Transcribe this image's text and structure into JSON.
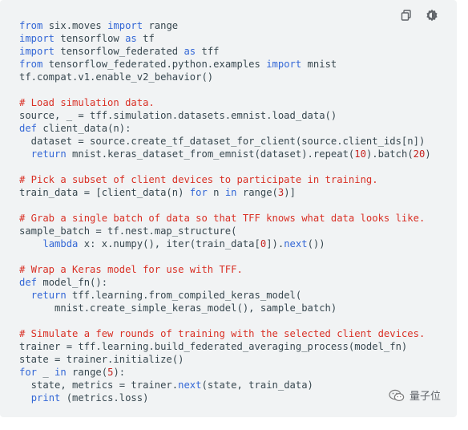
{
  "toolbar": {
    "copy_icon": "copy-icon",
    "theme_icon": "settings-brightness-icon"
  },
  "code": {
    "lines": [
      [
        {
          "t": "from",
          "c": "kw"
        },
        {
          "t": " six.moves ",
          "c": ""
        },
        {
          "t": "import",
          "c": "kw"
        },
        {
          "t": " range",
          "c": ""
        }
      ],
      [
        {
          "t": "import",
          "c": "kw"
        },
        {
          "t": " tensorflow ",
          "c": ""
        },
        {
          "t": "as",
          "c": "kw"
        },
        {
          "t": " tf",
          "c": ""
        }
      ],
      [
        {
          "t": "import",
          "c": "kw"
        },
        {
          "t": " tensorflow_federated ",
          "c": ""
        },
        {
          "t": "as",
          "c": "kw"
        },
        {
          "t": " tff",
          "c": ""
        }
      ],
      [
        {
          "t": "from",
          "c": "kw"
        },
        {
          "t": " tensorflow_federated.python.examples ",
          "c": ""
        },
        {
          "t": "import",
          "c": "kw"
        },
        {
          "t": " mnist",
          "c": ""
        }
      ],
      [
        {
          "t": "tf.compat.v1.enable_v2_behavior()",
          "c": ""
        }
      ],
      [
        {
          "t": "",
          "c": ""
        }
      ],
      [
        {
          "t": "# Load simulation data.",
          "c": "cm"
        }
      ],
      [
        {
          "t": "source, _ = tff.simulation.datasets.emnist.load_data()",
          "c": ""
        }
      ],
      [
        {
          "t": "def",
          "c": "kw"
        },
        {
          "t": " client_data(n):",
          "c": ""
        }
      ],
      [
        {
          "t": "  dataset = source.create_tf_dataset_for_client(source.client_ids[n])",
          "c": ""
        }
      ],
      [
        {
          "t": "  ",
          "c": ""
        },
        {
          "t": "return",
          "c": "kw"
        },
        {
          "t": " mnist.keras_dataset_from_emnist(dataset).repeat(",
          "c": ""
        },
        {
          "t": "10",
          "c": "num"
        },
        {
          "t": ").batch(",
          "c": ""
        },
        {
          "t": "20",
          "c": "num"
        },
        {
          "t": ")",
          "c": ""
        }
      ],
      [
        {
          "t": "",
          "c": ""
        }
      ],
      [
        {
          "t": "# Pick a subset of client devices to participate in training.",
          "c": "cm"
        }
      ],
      [
        {
          "t": "train_data = [client_data(n) ",
          "c": ""
        },
        {
          "t": "for",
          "c": "kw"
        },
        {
          "t": " n ",
          "c": ""
        },
        {
          "t": "in",
          "c": "kw"
        },
        {
          "t": " range(",
          "c": ""
        },
        {
          "t": "3",
          "c": "num"
        },
        {
          "t": ")]",
          "c": ""
        }
      ],
      [
        {
          "t": "",
          "c": ""
        }
      ],
      [
        {
          "t": "# Grab a single batch of data so that TFF knows what data looks like.",
          "c": "cm"
        }
      ],
      [
        {
          "t": "sample_batch = tf.nest.map_structure(",
          "c": ""
        }
      ],
      [
        {
          "t": "    ",
          "c": ""
        },
        {
          "t": "lambda",
          "c": "kw"
        },
        {
          "t": " x: x.numpy(), iter(train_data[",
          "c": ""
        },
        {
          "t": "0",
          "c": "num"
        },
        {
          "t": "]).",
          "c": ""
        },
        {
          "t": "next",
          "c": "kw"
        },
        {
          "t": "())",
          "c": ""
        }
      ],
      [
        {
          "t": "",
          "c": ""
        }
      ],
      [
        {
          "t": "# Wrap a Keras model for use with TFF.",
          "c": "cm"
        }
      ],
      [
        {
          "t": "def",
          "c": "kw"
        },
        {
          "t": " model_fn():",
          "c": ""
        }
      ],
      [
        {
          "t": "  ",
          "c": ""
        },
        {
          "t": "return",
          "c": "kw"
        },
        {
          "t": " tff.learning.from_compiled_keras_model(",
          "c": ""
        }
      ],
      [
        {
          "t": "      mnist.create_simple_keras_model(), sample_batch)",
          "c": ""
        }
      ],
      [
        {
          "t": "",
          "c": ""
        }
      ],
      [
        {
          "t": "# Simulate a few rounds of training with the selected client devices.",
          "c": "cm"
        }
      ],
      [
        {
          "t": "trainer = tff.learning.build_federated_averaging_process(model_fn)",
          "c": ""
        }
      ],
      [
        {
          "t": "state = trainer.initialize()",
          "c": ""
        }
      ],
      [
        {
          "t": "for",
          "c": "kw"
        },
        {
          "t": " _ ",
          "c": ""
        },
        {
          "t": "in",
          "c": "kw"
        },
        {
          "t": " range(",
          "c": ""
        },
        {
          "t": "5",
          "c": "num"
        },
        {
          "t": "):",
          "c": ""
        }
      ],
      [
        {
          "t": "  state, metrics = trainer.",
          "c": ""
        },
        {
          "t": "next",
          "c": "kw"
        },
        {
          "t": "(state, train_data)",
          "c": ""
        }
      ],
      [
        {
          "t": "  ",
          "c": ""
        },
        {
          "t": "print",
          "c": "kw"
        },
        {
          "t": " (metrics.loss)",
          "c": ""
        }
      ]
    ]
  },
  "watermark": {
    "label": "量子位",
    "icon": "wechat-icon"
  }
}
